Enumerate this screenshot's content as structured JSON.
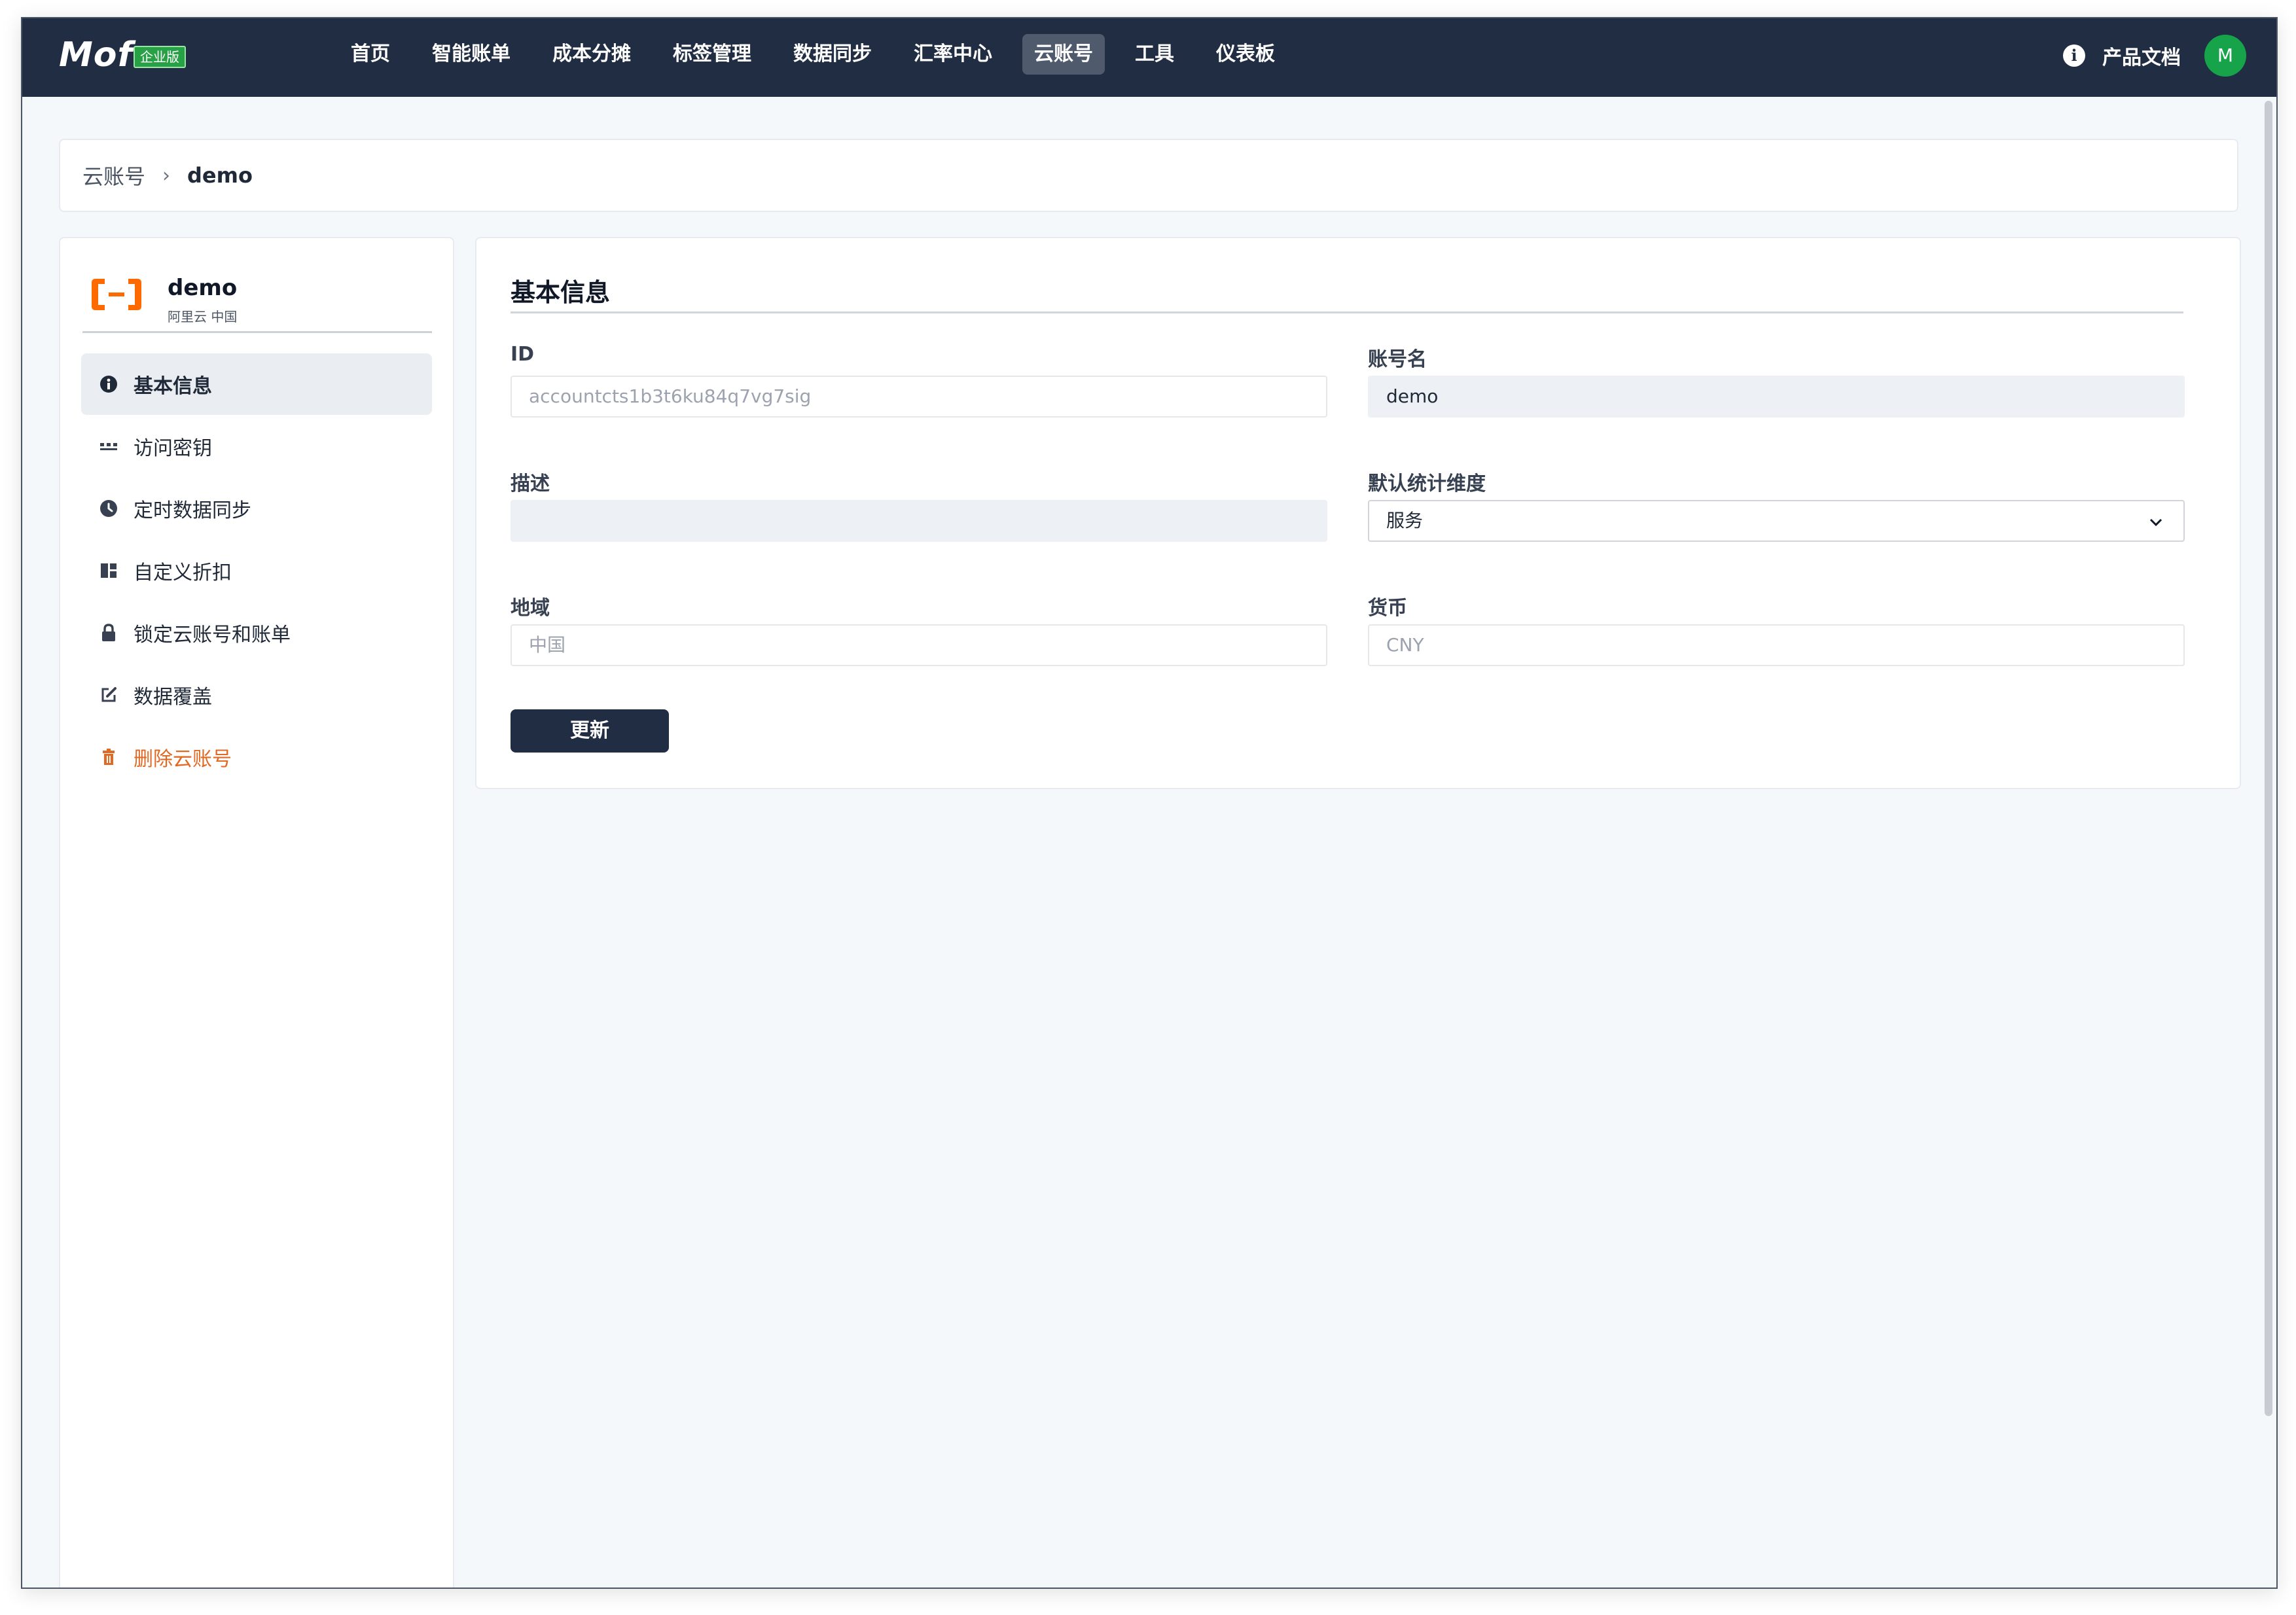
{
  "app": {
    "logo": "Mof",
    "edition_badge": "企业版"
  },
  "nav": {
    "items": [
      {
        "label": "首页",
        "active": false
      },
      {
        "label": "智能账单",
        "active": false
      },
      {
        "label": "成本分摊",
        "active": false
      },
      {
        "label": "标签管理",
        "active": false
      },
      {
        "label": "数据同步",
        "active": false
      },
      {
        "label": "汇率中心",
        "active": false
      },
      {
        "label": "云账号",
        "active": true
      },
      {
        "label": "工具",
        "active": false
      },
      {
        "label": "仪表板",
        "active": false
      }
    ],
    "docs_label": "产品文档",
    "avatar_letter": "M"
  },
  "breadcrumb": {
    "root": "云账号",
    "separator": "›",
    "current": "demo"
  },
  "account": {
    "name": "demo",
    "subtitle": "阿里云 中国"
  },
  "sidebar": {
    "items": [
      {
        "label": "基本信息",
        "icon": "info-icon",
        "active": true
      },
      {
        "label": "访问密钥",
        "icon": "key-dots-icon",
        "active": false
      },
      {
        "label": "定时数据同步",
        "icon": "clock-icon",
        "active": false
      },
      {
        "label": "自定义折扣",
        "icon": "ticket-icon",
        "active": false
      },
      {
        "label": "锁定云账号和账单",
        "icon": "lock-icon",
        "active": false
      },
      {
        "label": "数据覆盖",
        "icon": "edit-icon",
        "active": false
      },
      {
        "label": "删除云账号",
        "icon": "trash-icon",
        "active": false,
        "danger": true
      }
    ]
  },
  "form": {
    "title": "基本信息",
    "id_label": "ID",
    "id_placeholder": "accountcts1b3t6ku84q7vg7sig",
    "name_label": "账号名",
    "name_value": "demo",
    "desc_label": "描述",
    "desc_value": "",
    "dimension_label": "默认统计维度",
    "dimension_value": "服务",
    "region_label": "地域",
    "region_placeholder": "中国",
    "currency_label": "货币",
    "currency_placeholder": "CNY",
    "submit_label": "更新"
  },
  "colors": {
    "topbar": "#212d42",
    "nav_active": "#4f5a6c",
    "edition_badge": "#27a046",
    "avatar": "#16a34a",
    "danger": "#e06a23",
    "cloud_logo": "#ff6a00"
  }
}
